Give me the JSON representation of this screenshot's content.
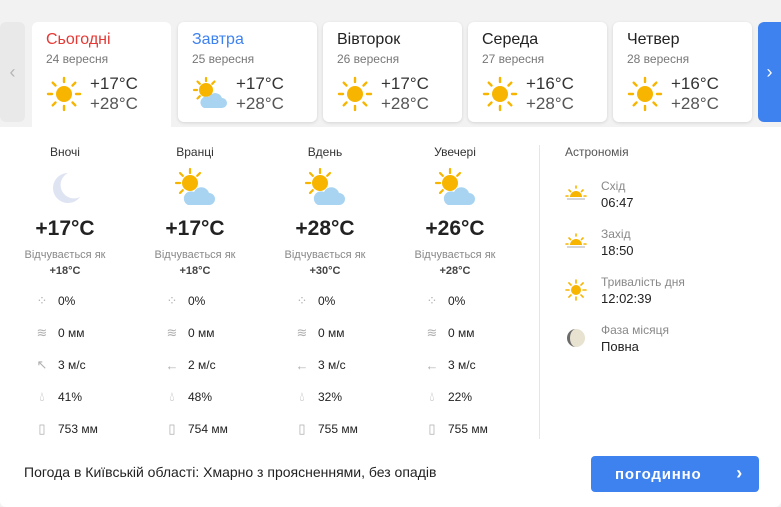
{
  "colors": {
    "accent": "#3e82f0",
    "today": "#e53935",
    "sun": "#f7b500"
  },
  "days": [
    {
      "name": "Сьогодні",
      "date": "24 вересня",
      "min": "+17°C",
      "max": "+28°C",
      "icon": "sun-icon",
      "name_color": "#e53935"
    },
    {
      "name": "Завтра",
      "date": "25 вересня",
      "min": "+17°C",
      "max": "+28°C",
      "icon": "sun-cloud-icon",
      "name_color": "#3e82f0"
    },
    {
      "name": "Вівторок",
      "date": "26 вересня",
      "min": "+17°C",
      "max": "+28°C",
      "icon": "sun-icon",
      "name_color": "#222222"
    },
    {
      "name": "Середа",
      "date": "27 вересня",
      "min": "+16°C",
      "max": "+28°C",
      "icon": "sun-icon",
      "name_color": "#222222"
    },
    {
      "name": "Четвер",
      "date": "28 вересня",
      "min": "+16°C",
      "max": "+28°C",
      "icon": "sun-icon",
      "name_color": "#222222"
    }
  ],
  "periods": [
    {
      "title": "Вночі",
      "icon": "moon-icon",
      "temp": "+17°C",
      "feels_label": "Відчувається як",
      "feels": "+18°C",
      "precip": "0%",
      "amount": "0 мм",
      "wind": "3 м/с",
      "wind_dir_icon": "arrow-up-left-icon",
      "humidity": "41%",
      "pressure": "753 мм"
    },
    {
      "title": "Вранці",
      "icon": "sun-cloud-icon",
      "temp": "+17°C",
      "feels_label": "Відчувається як",
      "feels": "+18°C",
      "precip": "0%",
      "amount": "0 мм",
      "wind": "2 м/с",
      "wind_dir_icon": "arrow-left-icon",
      "humidity": "48%",
      "pressure": "754 мм"
    },
    {
      "title": "Вдень",
      "icon": "sun-cloud-icon",
      "temp": "+28°C",
      "feels_label": "Відчувається як",
      "feels": "+30°C",
      "precip": "0%",
      "amount": "0 мм",
      "wind": "3 м/с",
      "wind_dir_icon": "arrow-left-icon",
      "humidity": "32%",
      "pressure": "755 мм"
    },
    {
      "title": "Увечері",
      "icon": "sun-cloud-icon",
      "temp": "+26°C",
      "feels_label": "Відчувається як",
      "feels": "+28°C",
      "precip": "0%",
      "amount": "0 мм",
      "wind": "3 м/с",
      "wind_dir_icon": "arrow-left-icon",
      "humidity": "22%",
      "pressure": "755 мм"
    }
  ],
  "astronomy": {
    "title": "Астрономія",
    "items": [
      {
        "label": "Схід",
        "value": "06:47",
        "icon": "sunrise-icon"
      },
      {
        "label": "Захід",
        "value": "18:50",
        "icon": "sunset-icon"
      },
      {
        "label": "Тривалість дня",
        "value": "12:02:39",
        "icon": "sun-icon"
      },
      {
        "label": "Фаза місяця",
        "value": "Повна",
        "icon": "moon-phase-icon"
      }
    ]
  },
  "summary": "Погода в Київській області: Хмарно з проясненнями, без опадів",
  "hourly_button": "погодинно"
}
